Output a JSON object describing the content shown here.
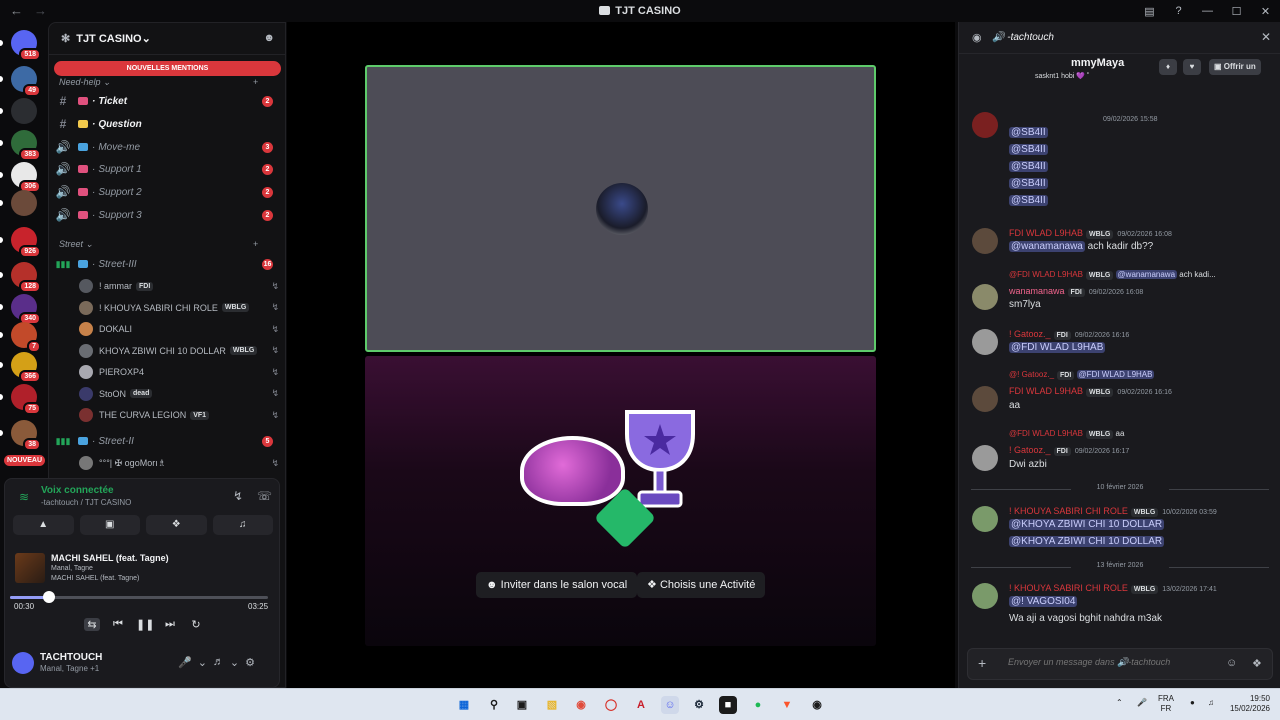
{
  "window": {
    "title": "TJT CASINO"
  },
  "servers": [
    {
      "badge": "518",
      "color": "#5865f2"
    },
    {
      "badge": "49",
      "color": "#3d6aa5"
    },
    {
      "badge": "",
      "color": "#2b2d31"
    },
    {
      "badge": "383",
      "color": "#2f6b3a"
    },
    {
      "badge": "306",
      "color": "#e8e8e8"
    },
    {
      "badge": "",
      "color": "#6b4a3a"
    },
    {
      "badge": "926",
      "color": "#c8232c"
    },
    {
      "badge": "128",
      "color": "#b5302a"
    },
    {
      "badge": "340",
      "color": "#5a2e8a"
    },
    {
      "badge": "7",
      "color": "#c24a2a"
    },
    {
      "badge": "366",
      "color": "#d4a017"
    },
    {
      "badge": "75",
      "color": "#b0202a"
    },
    {
      "badge": "38",
      "color": "#8a5a3a"
    }
  ],
  "new_badge": "NOUVEAU",
  "guild": {
    "name": "TJT CASINO",
    "mentions_banner": "NOUVELLES MENTIONS"
  },
  "categories": {
    "need_help": "Need-help",
    "street": "Street"
  },
  "channels": [
    {
      "name": "Ticket",
      "type": "text",
      "badge": "2",
      "bold": true,
      "emoji_color": "#e0517e"
    },
    {
      "name": "Question",
      "type": "text",
      "badge": "",
      "bold": true,
      "emoji_color": "#f2c94c"
    },
    {
      "name": "Move-me",
      "type": "voice",
      "badge": "3",
      "bold": false,
      "emoji_color": "#4aa3df"
    },
    {
      "name": "Support 1",
      "type": "voice",
      "badge": "2",
      "bold": false,
      "emoji_color": "#e0517e"
    },
    {
      "name": "Support 2",
      "type": "voice",
      "badge": "2",
      "bold": false,
      "emoji_color": "#e0517e"
    },
    {
      "name": "Support 3",
      "type": "voice",
      "badge": "2",
      "bold": false,
      "emoji_color": "#e0517e"
    }
  ],
  "street_channels": [
    {
      "name": "Street-III",
      "badge": "16"
    },
    {
      "name": "Street-II",
      "badge": "5"
    }
  ],
  "voice_users": [
    {
      "name": "! ammar",
      "tag": "FDI",
      "color": "#55585f"
    },
    {
      "name": "! KHOUYA SABIRI CHI ROLE",
      "tag": "WBLG",
      "color": "#7a6a5a"
    },
    {
      "name": "DOKALI",
      "tag": "",
      "color": "#c7824a"
    },
    {
      "name": "KHOYA ZBIWI CHI 10 DOLLAR",
      "tag": "WBLG",
      "color": "#6a6d73"
    },
    {
      "name": "PIEROXP4",
      "tag": "",
      "color": "#a8a8b0"
    },
    {
      "name": "StoON",
      "tag": "dead",
      "color": "#3a3a6a"
    },
    {
      "name": "THE CURVA LEGION",
      "tag": "VF1",
      "color": "#7a3030"
    }
  ],
  "street2_user": {
    "name": "°°°| ✠ ogoMorı♗"
  },
  "voice_panel": {
    "status": "Voix connectée",
    "location": "-tachtouch / TJT CASINO"
  },
  "music": {
    "song": "MACHI SAHEL (feat. Tagne)",
    "artists": "Manal, Tagne",
    "album": "MACHI SAHEL (feat. Tagne)",
    "current": "00:30",
    "total": "03:25",
    "progress": 0.15
  },
  "me": {
    "name": "TACHTOUCH",
    "status": "Manal, Tagne +1"
  },
  "stage": {
    "invite_label": "Inviter dans le salon vocal",
    "activity_label": "Choisis une Activité"
  },
  "chat": {
    "channel": "-tachtouch",
    "profile_name": "mmyMaya",
    "profile_bio": "sasknt1 hobi 💜 ˚",
    "offer_label": "Offrir un",
    "date1": "09/02/2026 15:58",
    "sb_mentions": [
      "@SB4II",
      "@SB4II",
      "@SB4II",
      "@SB4II",
      "@SB4II"
    ],
    "m1": {
      "author": "FDI WLAD L9HAB",
      "tag": "WBLG",
      "time": "09/02/2026 16:08",
      "mention": "@wanamanawa",
      "text": "ach kadir db??"
    },
    "m2_reply": {
      "author": "@FDI WLAD L9HAB",
      "tag": "WBLG",
      "mention": "@wanamanawa",
      "text": "ach kadi..."
    },
    "m2": {
      "author": "wanamanawa",
      "tag": "FDI",
      "time": "09/02/2026 16:08",
      "text": "sm7lya"
    },
    "m3": {
      "author": "!          Gatooz._",
      "tag": "FDI",
      "time": "09/02/2026 16:16",
      "mention": "@FDI WLAD L9HAB"
    },
    "m4_reply": {
      "author": "@!              Gatooz._",
      "tag": "FDI",
      "mention": "@FDI WLAD L9HAB"
    },
    "m4": {
      "author": "FDI WLAD L9HAB",
      "tag": "WBLG",
      "time": "09/02/2026 16:16",
      "text": "aa"
    },
    "m5_reply": {
      "author": "@FDI WLAD L9HAB",
      "tag": "WBLG",
      "text": "aa"
    },
    "m5": {
      "author": "!          Gatooz._",
      "tag": "FDI",
      "time": "09/02/2026 16:17",
      "text": "Dwi azbi"
    },
    "day1": "10 février 2026",
    "m6": {
      "author": "!  KHOUYA SABIRI CHI ROLE",
      "tag": "WBLG",
      "time": "10/02/2026 03:59",
      "mentions": [
        "@KHOYA ZBIWI CHI 10 DOLLAR",
        "@KHOYA ZBIWI CHI 10 DOLLAR"
      ]
    },
    "day2": "13 février 2026",
    "m7": {
      "author": "!  KHOUYA SABIRI CHI ROLE",
      "tag": "WBLG",
      "time": "13/02/2026 17:41",
      "mention": "@!          VAGOSI04",
      "text": "Wa aji a vagosi bghit nahdra m3ak"
    },
    "composer_placeholder": "Envoyer un message dans 🔊-tachtouch"
  },
  "taskbar": {
    "lang": "FRA",
    "lang2": "FR",
    "time": "19:50",
    "date": "15/02/2026"
  }
}
